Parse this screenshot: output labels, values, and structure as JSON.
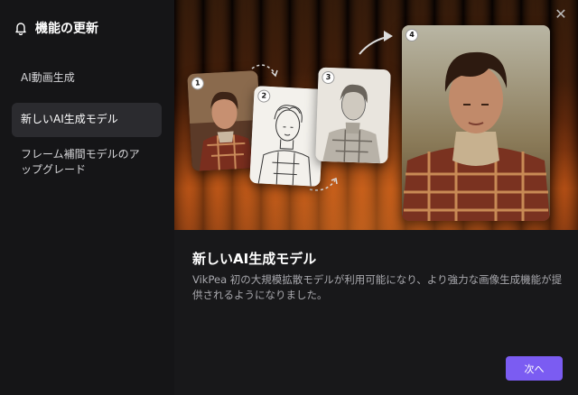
{
  "sidebar": {
    "header_title": "機能の更新",
    "items": [
      {
        "label": "AI動画生成"
      },
      {
        "label": "新しいAI生成モデル"
      },
      {
        "label": "フレーム補間モデルのアップグレード"
      }
    ]
  },
  "main": {
    "close_icon": "close-icon",
    "title": "新しいAI生成モデル",
    "description": "VikPea 初の大規模拡散モデルが利用可能になり、より強力な画像生成機能が提供されるようになりました。",
    "next_label": "次へ",
    "steps": [
      "1",
      "2",
      "3",
      "4"
    ]
  },
  "colors": {
    "accent": "#7b5cf2",
    "sidebar_bg": "#151517",
    "main_bg": "#18181a",
    "active_item_bg": "#2b2b2f"
  }
}
